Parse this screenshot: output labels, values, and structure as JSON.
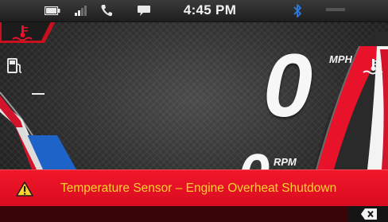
{
  "status_bar": {
    "time": "4:45 PM",
    "icons": [
      "battery-icon",
      "signal-icon",
      "phone-icon",
      "message-icon",
      "bluetooth-icon"
    ]
  },
  "speedometer": {
    "speed": "0",
    "speed_unit": "MPH",
    "rpm": "0",
    "rpm_unit": "RPM",
    "fuel_level_fraction": 0.25
  },
  "alert": {
    "message": "Temperature Sensor – Engine Overheat Shutdown",
    "icon": "warning-icon",
    "dismiss_icon": "close-icon"
  },
  "colors": {
    "alert_background": "#e8122a",
    "alert_text": "#ffd22e",
    "gauge_red": "#e8122a",
    "gauge_blue": "#1e63c8",
    "tint_blue": "#2b7be0"
  }
}
